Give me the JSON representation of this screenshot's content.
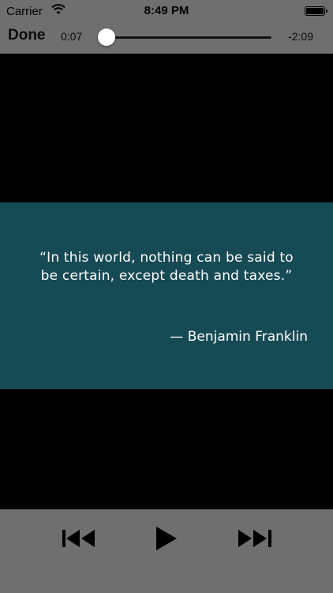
{
  "status_bar": {
    "carrier": "Carrier",
    "time": "8:49 PM",
    "battery_level": 1.0,
    "wifi_icon": "wifi-icon",
    "battery_icon": "battery-icon"
  },
  "player": {
    "done_label": "Done",
    "elapsed": "0:07",
    "remaining": "-2:09",
    "progress": 0.05
  },
  "video": {
    "quote_line_1": "“In this world, nothing can be said to",
    "quote_line_2": "be certain, except death and taxes.”",
    "attribution": "— Benjamin Franklin"
  },
  "controls": {
    "prev_icon": "skip-back-icon",
    "play_icon": "play-icon",
    "next_icon": "skip-forward-icon"
  },
  "colors": {
    "bar_gray": "#6f6f6f",
    "quote_band": "#164a55",
    "letterbox": "#000000"
  }
}
